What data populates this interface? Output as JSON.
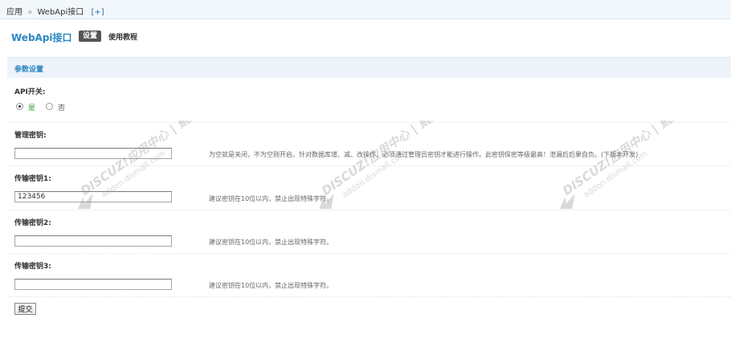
{
  "breadcrumb": {
    "root": "应用",
    "separator": "»",
    "current": "WebApi接口",
    "add": "[+]"
  },
  "header": {
    "title": "WebApi接口",
    "tab_active": "设置",
    "tab_other": "使用教程"
  },
  "section": {
    "title": "参数设置"
  },
  "api_switch": {
    "label": "API开关:",
    "options": [
      {
        "label": "是",
        "checked": true
      },
      {
        "label": "否",
        "checked": false
      }
    ]
  },
  "admin_key": {
    "label": "管理密钥:",
    "value": "",
    "hint": "为空就是关闭，不为空则开启。针对数据库增、减、改操作，必须通过管理员密钥才能进行操作。此密钥保密等级最高！泄漏后后果自负。(下版本开发)"
  },
  "transfer_key_1": {
    "label": "传输密钥1:",
    "value": "123456",
    "hint": "建议密钥在10位以内，禁止出现特殊字符。"
  },
  "transfer_key_2": {
    "label": "传输密钥2:",
    "value": "",
    "hint": "建议密钥在10位以内，禁止出现特殊字符。"
  },
  "transfer_key_3": {
    "label": "传输密钥3:",
    "value": "",
    "hint": "建议密钥在10位以内，禁止出现特殊字符。"
  },
  "submit": {
    "label": "提交"
  },
  "watermark": {
    "line1": "DISCUZ!应用中心 | 贰道",
    "line2": "addon.dismall.com"
  },
  "colors": {
    "accent": "#2b87c3",
    "section_bg": "#eef4f9",
    "yes_green": "#2a9c2a"
  }
}
